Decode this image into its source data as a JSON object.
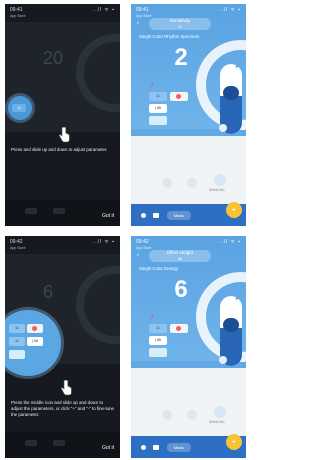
{
  "status": {
    "time_1": "09:41",
    "time_2": "09:42",
    "signal": "..ll ᯤ ▪"
  },
  "app_store_back": "App Store",
  "tutorial_1": {
    "instruction": "Press and slide up and down to adjust parameter.",
    "got_it": "Got it",
    "spot_value": "11"
  },
  "tutorial_2": {
    "instruction": "Press the middle icon and slide up and down to adjust the parameters, or click \"+\" and \"-\" to fine-tune the parameter.",
    "got_it": "Got it",
    "cell_1": "11",
    "cell_3": "11",
    "cell_4": "| 66"
  },
  "sensitivity_screen": {
    "title": "Sensitivity",
    "title_value": "11",
    "mode": "Single Color Rhythm Spectrum",
    "value": "2",
    "cell_1": "11",
    "cell_3": "| 66",
    "plus": "+",
    "minus_caption": "Select Mic",
    "tab_label": "Music"
  },
  "effect_screen": {
    "title": "Effect Height",
    "title_value": "66",
    "mode": "Single Color Energy",
    "value": "6",
    "cell_1": "11",
    "cell_3": "| 66",
    "plus": "+",
    "minus_caption": "Select Mic",
    "tab_label": "Music"
  },
  "icons": {
    "hand": "hand-tap-icon",
    "note": "music-note-icon",
    "back": "chevron-left-icon",
    "fab": "plus-icon"
  },
  "colors": {
    "dark_bg": "#161a20",
    "blue_bg": "#61a8e4",
    "accent_yellow": "#f7c234",
    "tabbar_blue": "#2d6fc2"
  }
}
